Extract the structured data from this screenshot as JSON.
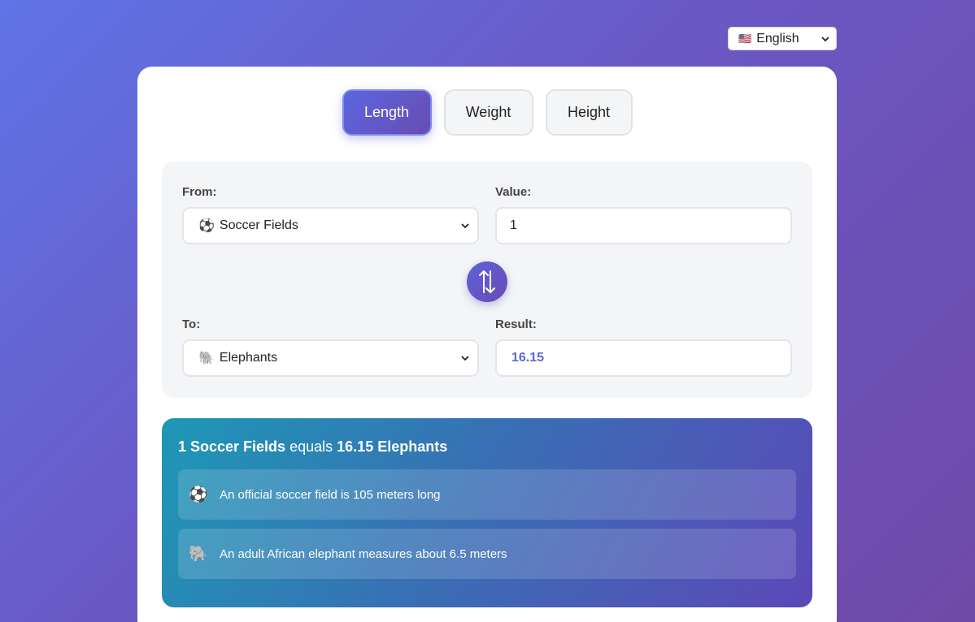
{
  "language": {
    "flag": "🇺🇸",
    "value": "English"
  },
  "tabs": [
    {
      "label": "Length",
      "active": true
    },
    {
      "label": "Weight",
      "active": false
    },
    {
      "label": "Height",
      "active": false
    }
  ],
  "converter": {
    "from_label": "From:",
    "from_unit": {
      "emoji": "⚽",
      "label": "Soccer Fields"
    },
    "value_label": "Value:",
    "value": "1",
    "to_label": "To:",
    "to_unit": {
      "emoji": "🐘",
      "label": "Elephants"
    },
    "result_label": "Result:",
    "result": "16.15"
  },
  "summary": {
    "from_text": "1 Soccer Fields",
    "connector": "equals",
    "to_text": "16.15 Elephants"
  },
  "facts": [
    {
      "emoji": "⚽",
      "text": "An official soccer field is 105 meters long"
    },
    {
      "emoji": "🐘",
      "text": "An adult African elephant measures about 6.5 meters"
    }
  ],
  "colors": {
    "accent": "#5a66e0",
    "result_text": "#5a6ad8"
  }
}
